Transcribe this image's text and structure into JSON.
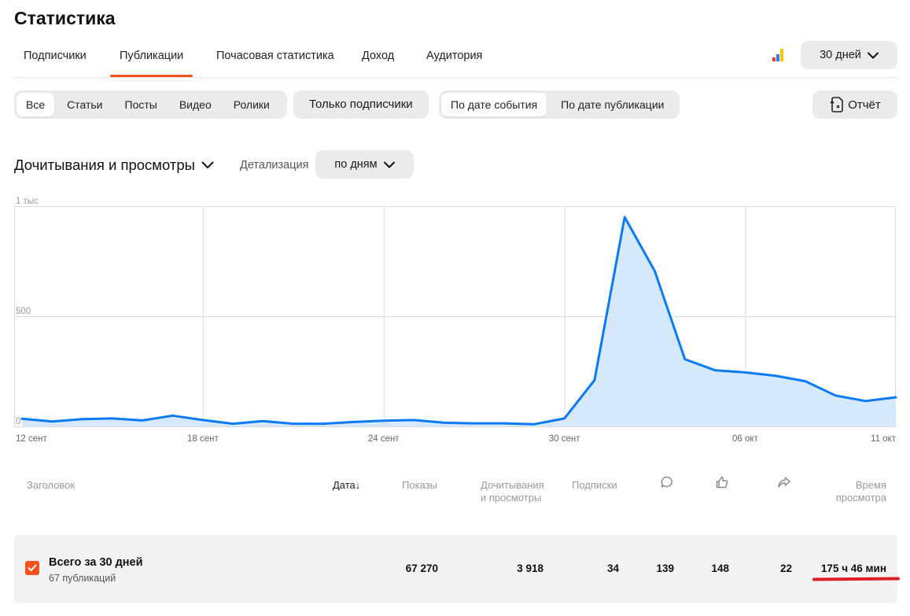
{
  "page": {
    "title": "Статистика"
  },
  "nav": {
    "tabs": [
      {
        "label": "Подписчики"
      },
      {
        "label": "Публикации",
        "active": true
      },
      {
        "label": "Почасовая статистика"
      },
      {
        "label": "Доход"
      },
      {
        "label": "Аудитория"
      }
    ],
    "accent_color": "#f5511e"
  },
  "period": {
    "label": "30 дней"
  },
  "type_filter": {
    "items": [
      {
        "label": "Все",
        "active": true
      },
      {
        "label": "Статьи"
      },
      {
        "label": "Посты"
      },
      {
        "label": "Видео"
      },
      {
        "label": "Ролики"
      }
    ]
  },
  "subscribers_only": {
    "label": "Только подписчики"
  },
  "date_mode": {
    "items": [
      {
        "label": "По дате события",
        "active": true
      },
      {
        "label": "По дате публикации"
      }
    ]
  },
  "report": {
    "label": "Отчёт"
  },
  "metric": {
    "label": "Дочитывания и просмотры"
  },
  "detail": {
    "label": "Детализация",
    "value": "по дням"
  },
  "chart_data": {
    "type": "area",
    "x": [
      "12 сент",
      "13 сент",
      "14 сент",
      "15 сент",
      "16 сент",
      "17 сент",
      "18 сент",
      "19 сент",
      "20 сент",
      "21 сент",
      "22 сент",
      "23 сент",
      "24 сент",
      "25 сент",
      "26 сент",
      "27 сент",
      "28 сент",
      "29 сент",
      "30 сент",
      "01 окт",
      "02 окт",
      "03 окт",
      "04 окт",
      "05 окт",
      "06 окт",
      "07 окт",
      "08 окт",
      "09 окт",
      "10 окт",
      "11 окт"
    ],
    "values": [
      35,
      22,
      33,
      36,
      27,
      49,
      29,
      12,
      24,
      12,
      12,
      20,
      26,
      29,
      17,
      14,
      14,
      10,
      36,
      210,
      950,
      705,
      305,
      255,
      245,
      230,
      205,
      140,
      115,
      132
    ],
    "xticks": [
      "12 сент",
      "18 сент",
      "24 сент",
      "30 сент",
      "06 окт",
      "11 окт"
    ],
    "yticks": [
      {
        "value": 1000,
        "label": "1 тыс"
      },
      {
        "value": 500,
        "label": "500"
      },
      {
        "value": 0,
        "label": "0"
      }
    ],
    "ylim": [
      0,
      1000
    ],
    "grid": true,
    "line_color": "#0a7af5",
    "fill_color": "#d6e8fb"
  },
  "table": {
    "headers": {
      "title": "Заголовок",
      "date": "Дата",
      "sort_arrow": "↓",
      "impressions": "Показы",
      "reads_line1": "Дочитывания",
      "reads_line2": "и просмотры",
      "subscriptions": "Подписки",
      "time_line1": "Время",
      "time_line2": "просмотра"
    },
    "header_icons": [
      "comment-icon",
      "like-icon",
      "share-icon"
    ],
    "total": {
      "title": "Всего за 30 дней",
      "subtitle": "67 публикаций",
      "impressions": "67 270",
      "reads": "3 918",
      "subscriptions": "34",
      "comments": "139",
      "likes": "148",
      "shares": "22",
      "watch_time": "175 ч 46 мин"
    }
  }
}
